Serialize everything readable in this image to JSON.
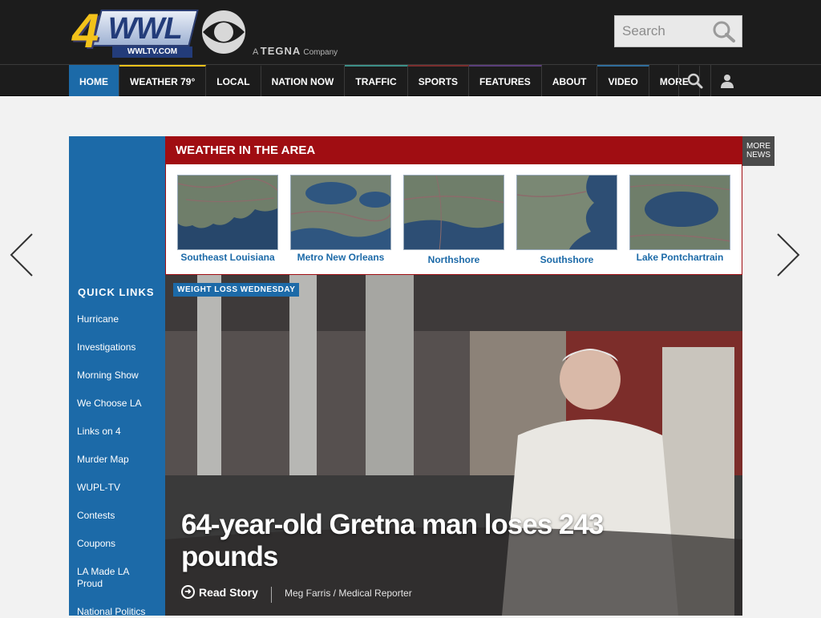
{
  "brand": {
    "logo_number": "4",
    "logo_letters": "WWL",
    "logo_domain": "WWLTV.COM",
    "network": "CBS",
    "tagline_prefix": "A",
    "tagline_brand": "TEGNA",
    "tagline_suffix": "Company"
  },
  "search": {
    "placeholder": "Search",
    "icon": "search-icon"
  },
  "nav": {
    "items": [
      {
        "label": "HOME",
        "active": true
      },
      {
        "label": "WEATHER  79°",
        "active": false
      },
      {
        "label": "LOCAL",
        "active": false
      },
      {
        "label": "NATION NOW",
        "active": false
      },
      {
        "label": "TRAFFIC",
        "active": false
      },
      {
        "label": "SPORTS",
        "active": false
      },
      {
        "label": "FEATURES",
        "active": false
      },
      {
        "label": "ABOUT",
        "active": false
      },
      {
        "label": "VIDEO",
        "active": false
      },
      {
        "label": "MORE",
        "active": false
      }
    ],
    "icons": [
      "search-icon",
      "user-icon"
    ]
  },
  "quick_links": {
    "title": "QUICK LINKS",
    "items": [
      "Hurricane",
      "Investigations",
      "Morning Show",
      "We Choose LA",
      "Links on 4",
      "Murder Map",
      "WUPL-TV",
      "Contests",
      "Coupons",
      "LA Made LA Proud",
      "National Politics"
    ]
  },
  "weather": {
    "title": "WEATHER IN THE AREA",
    "maps": [
      "Southeast Louisiana",
      "Metro New Orleans",
      "Northshore",
      "Southshore",
      "Lake Pontchartrain"
    ]
  },
  "more_news": {
    "line1": "MORE",
    "line2": "NEWS"
  },
  "story": {
    "tag": "WEIGHT LOSS WEDNESDAY",
    "headline": "64-year-old Gretna man loses 243 pounds",
    "read_label": "Read Story",
    "byline": "Meg Farris / Medical Reporter"
  },
  "colors": {
    "accent_blue": "#1c6aa8",
    "weather_red": "#a00d12",
    "topbar": "#1c1c1c",
    "logo_yellow": "#f3c21a"
  }
}
